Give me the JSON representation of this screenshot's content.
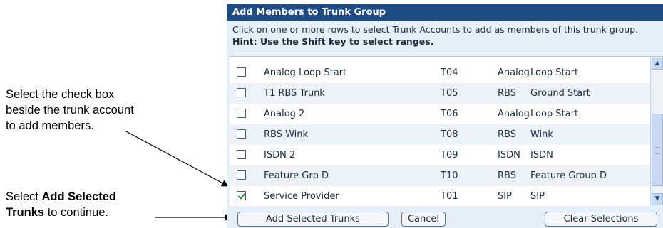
{
  "callouts": {
    "first": {
      "line1": "Select the check box",
      "line2": "beside the trunk account",
      "line3": "to add members."
    },
    "second": {
      "prefix": "Select ",
      "bold_line1": "Add Selected",
      "bold_line2": "Trunks",
      "suffix": " to continue."
    }
  },
  "dialog": {
    "title": "Add Members to Trunk Group",
    "instruction": "Click on one or more rows to select Trunk Accounts to add as members of this trunk group. ",
    "hint": "Hint: Use the Shift key to select ranges.",
    "rows": [
      {
        "name": "Analog Loop Start",
        "id": "T04",
        "type": "Analog",
        "signaling": "Loop Start",
        "checked": false
      },
      {
        "name": "T1 RBS Trunk",
        "id": "T05",
        "type": "RBS",
        "signaling": "Ground Start",
        "checked": false
      },
      {
        "name": "Analog 2",
        "id": "T06",
        "type": "Analog",
        "signaling": "Loop Start",
        "checked": false
      },
      {
        "name": "RBS Wink",
        "id": "T08",
        "type": "RBS",
        "signaling": "Wink",
        "checked": false
      },
      {
        "name": "ISDN 2",
        "id": "T09",
        "type": "ISDN",
        "signaling": "ISDN",
        "checked": false
      },
      {
        "name": "Feature Grp D",
        "id": "T10",
        "type": "RBS",
        "signaling": "Feature Group D",
        "checked": false
      },
      {
        "name": "Service Provider",
        "id": "T01",
        "type": "SIP",
        "signaling": "SIP",
        "checked": true
      }
    ],
    "buttons": {
      "add": "Add Selected Trunks",
      "cancel": "Cancel",
      "clear": "Clear Selections"
    },
    "scrollbar": {
      "up_icon": "arrow-up-icon",
      "down_icon": "arrow-down-icon"
    },
    "colors": {
      "title_bar": "#1e4b84",
      "dialog_bg": "#e6eef8",
      "checkmark": "#2f8a2f"
    }
  }
}
